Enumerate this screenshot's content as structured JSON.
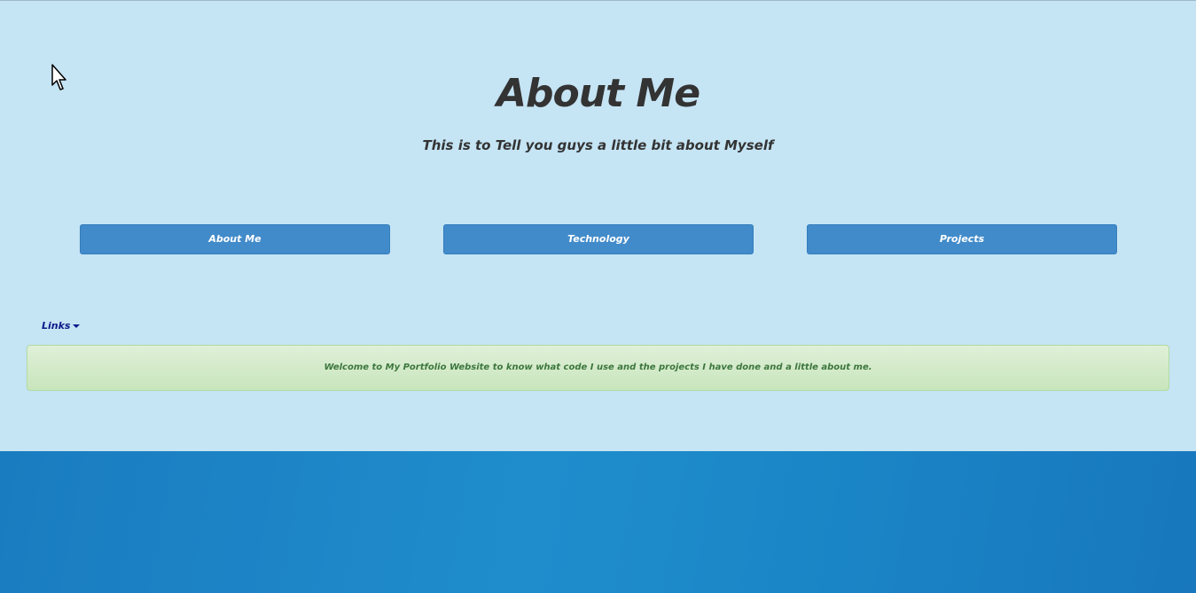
{
  "header": {
    "title": "About Me",
    "subtitle": "This is to Tell you guys a little bit about Myself"
  },
  "nav": {
    "buttons": [
      {
        "label": "About Me"
      },
      {
        "label": "Technology"
      },
      {
        "label": "Projects"
      }
    ]
  },
  "links_dropdown": {
    "label": "Links"
  },
  "alert": {
    "text": "Welcome to My Portfolio Website to know what code I use and the projects I have done and a little about me."
  },
  "colors": {
    "page_background": "#c5e4f4",
    "button_primary": "#428bca",
    "alert_success": "#dff0d8",
    "alert_text": "#3c763d",
    "footer_water": "#1a85c6"
  },
  "icons": {
    "cursor": "mouse-pointer-icon",
    "dropdown": "caret-down-icon"
  }
}
